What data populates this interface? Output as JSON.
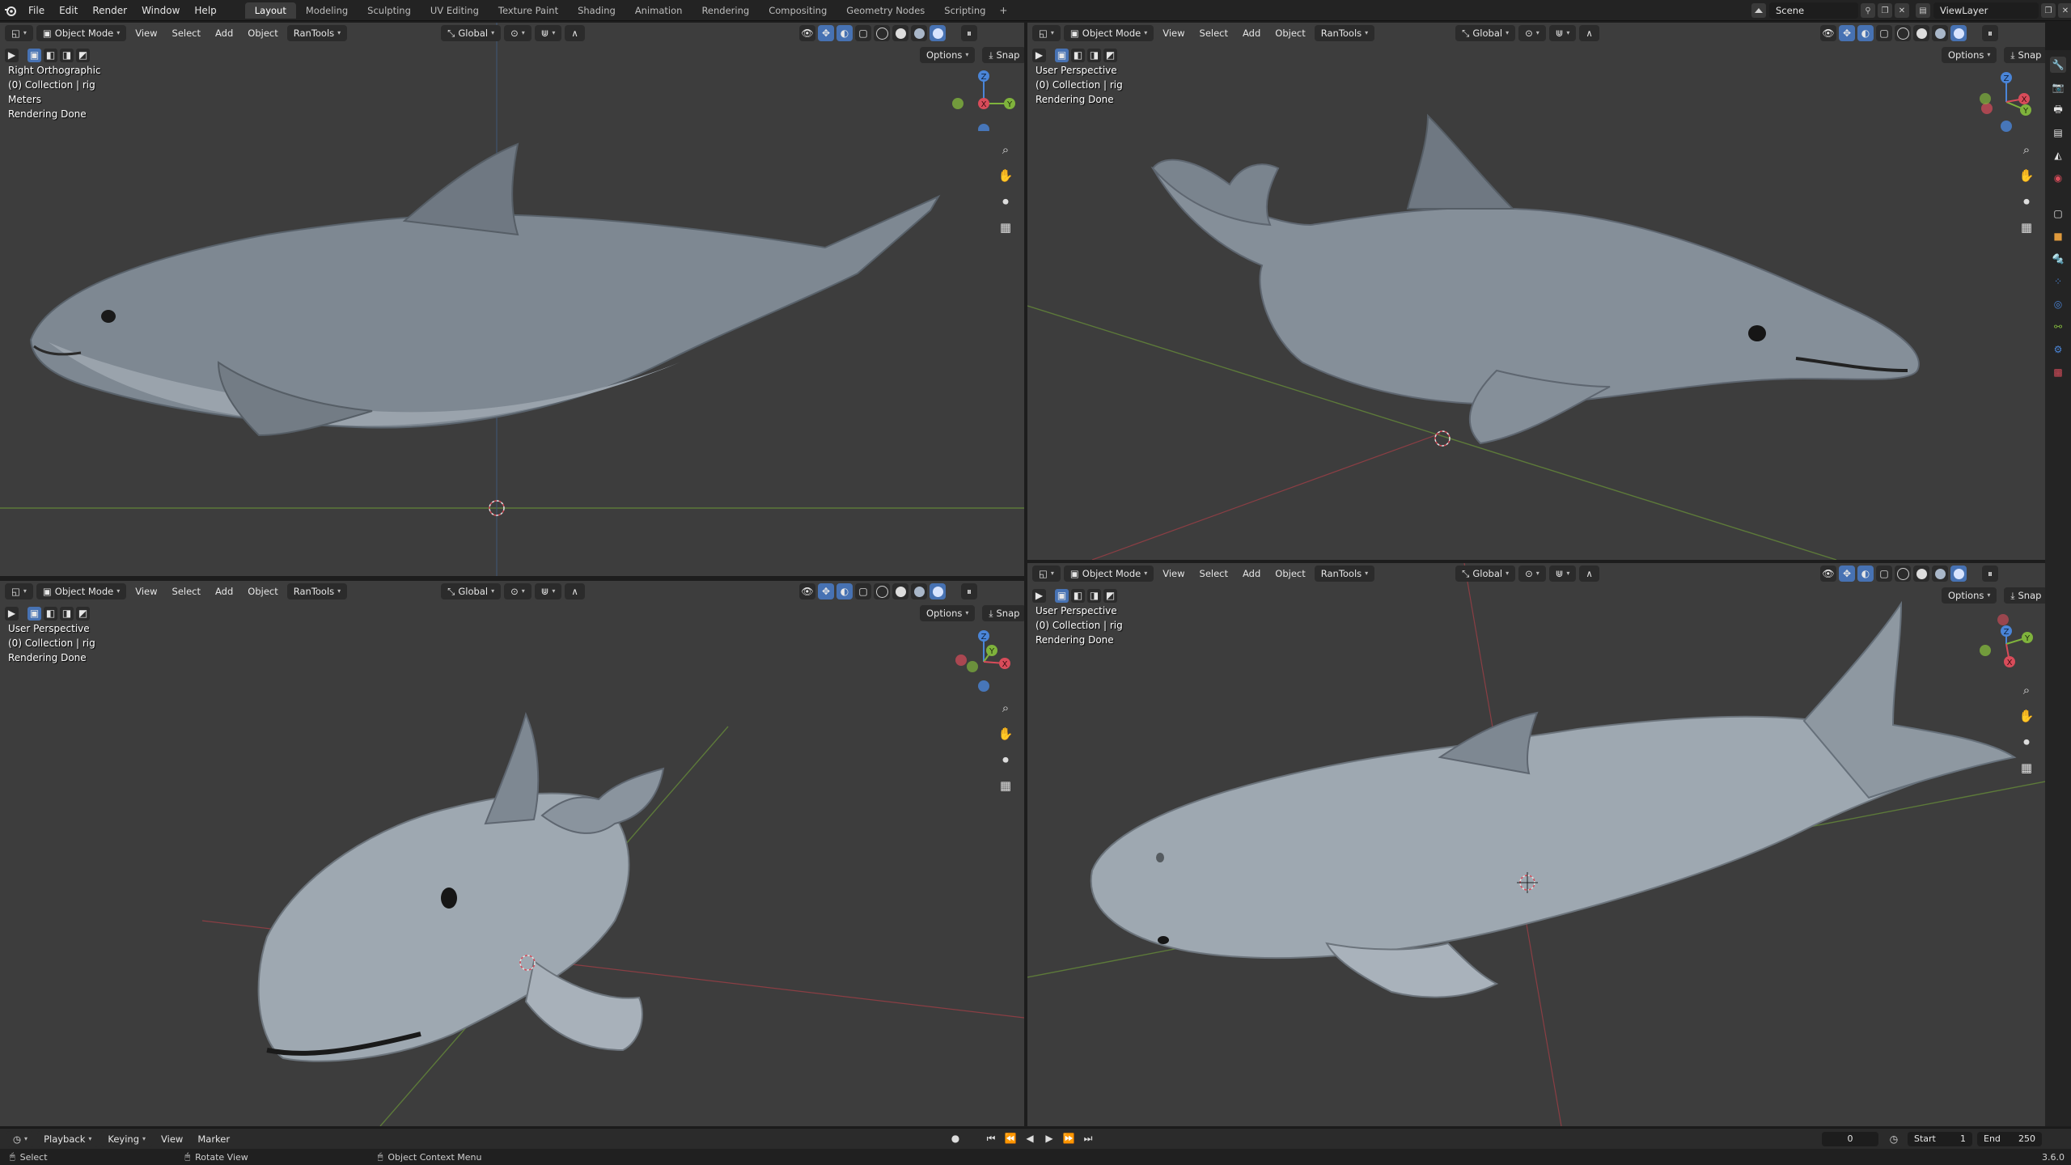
{
  "topbar": {
    "menus": [
      "File",
      "Edit",
      "Render",
      "Window",
      "Help"
    ],
    "workspaces": [
      "Layout",
      "Modeling",
      "Sculpting",
      "UV Editing",
      "Texture Paint",
      "Shading",
      "Animation",
      "Rendering",
      "Compositing",
      "Geometry Nodes",
      "Scripting"
    ],
    "active_workspace": "Layout",
    "add_workspace": "+",
    "scene": "Scene",
    "view_layer": "ViewLayer"
  },
  "viewport_header": {
    "mode": "Object Mode",
    "menus": [
      "View",
      "Select",
      "Add",
      "Object",
      "RanTools"
    ],
    "orientation": "Global",
    "options": "Options",
    "snap": "Snap"
  },
  "viewports": [
    {
      "id": "top-left",
      "overlay": [
        "Right Orthographic",
        "(0) Collection | rig",
        "Meters",
        "Rendering Done"
      ]
    },
    {
      "id": "top-right",
      "overlay": [
        "User Perspective",
        "(0) Collection | rig",
        "Rendering Done"
      ]
    },
    {
      "id": "bottom-left",
      "overlay": [
        "User Perspective",
        "(0) Collection | rig",
        "Rendering Done"
      ]
    },
    {
      "id": "bottom-right",
      "overlay": [
        "User Perspective",
        "(0) Collection | rig",
        "Rendering Done"
      ]
    }
  ],
  "gizmo_axes": {
    "x": "X",
    "y": "Y",
    "z": "Z"
  },
  "timeline": {
    "menus": [
      "Playback",
      "Keying",
      "View",
      "Marker"
    ],
    "current_frame": "0",
    "start_label": "Start",
    "start": "1",
    "end_label": "End",
    "end": "250"
  },
  "statusbar": {
    "select": "Select",
    "rotate": "Rotate View",
    "context": "Object Context Menu",
    "version": "3.6.0"
  },
  "colors": {
    "viewport_bg": "#3d3d3d",
    "axis_x": "#d84c5a",
    "axis_y": "#7fb33c",
    "axis_z": "#4a85d8",
    "accent": "#4772b3"
  }
}
